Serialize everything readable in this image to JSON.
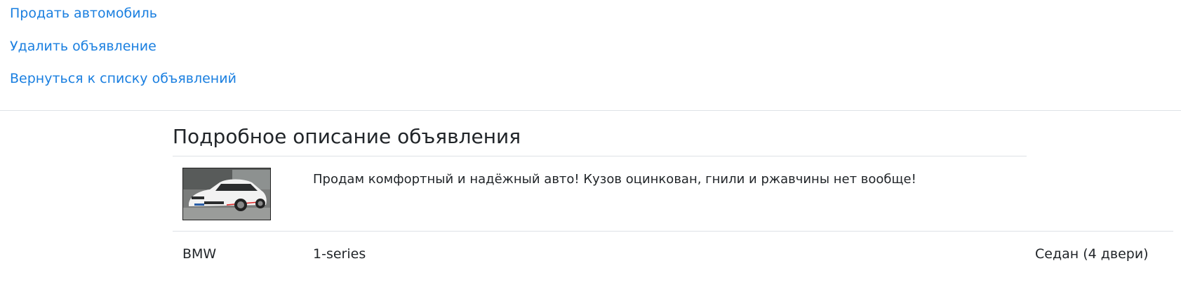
{
  "nav": {
    "sell_car": "Продать автомобиль",
    "delete_listing": "Удалить объявление",
    "back_to_list": "Вернуться к списку объявлений"
  },
  "listing": {
    "heading": "Подробное описание объявления",
    "description": "Продам комфортный и надёжный авто! Кузов оцинкован, гнили и ржавчины нет вообще!",
    "brand": "BMW",
    "model": "1-series",
    "body_type": "Седан (4 двери)"
  },
  "colors": {
    "link": "#1a7fe0",
    "text": "#212529",
    "divider": "#dee2e6"
  }
}
